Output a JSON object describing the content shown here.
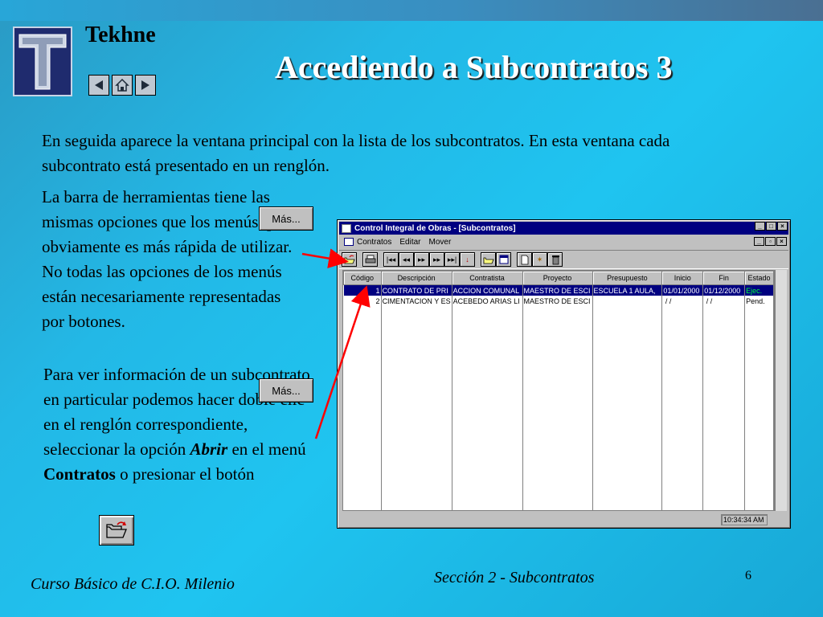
{
  "brand": "Tekhne",
  "title": "Accediendo a Subcontratos 3",
  "intro": "En seguida aparece la ventana principal con la lista de los subcontratos. En esta ventana cada subcontrato está presentado en un renglón.",
  "toolbar_para": "La barra de herramientas tiene las mismas opciones que los menús, pero obviamente es más rápida de utilizar. No todas las opciones de los menús están necesariamente representadas por botones.",
  "open_para": {
    "part1": "Para ver información de un subcontrato en particular podemos hacer doble clic en el renglón correspondiente, seleccionar la opción ",
    "abrir": "Abrir",
    "part2": " en el menú ",
    "contratos": "Contratos",
    "part3": " o presionar el botón"
  },
  "mas_label": "Más...",
  "window": {
    "title": "Control Integral de Obras - [Subcontratos]",
    "menus": [
      "Contratos",
      "Editar",
      "Mover"
    ],
    "columns": [
      "Código",
      "Descripción",
      "Contratista",
      "Proyecto",
      "Presupuesto",
      "Inicio",
      "Fin",
      "Estado"
    ],
    "rows": [
      [
        "1",
        "CONTRATO DE PRI",
        "ACCION COMUNAL",
        "MAESTRO DE ESCI",
        "ESCUELA 1 AULA,",
        "01/01/2000",
        "01/12/2000",
        "Ejec."
      ],
      [
        "2",
        "CIMENTACION Y ES",
        "ACEBEDO ARIAS LI",
        "MAESTRO DE ESCI",
        "",
        " / /",
        " / /",
        "Pend."
      ]
    ],
    "clock": "10:34:34 AM"
  },
  "footer_left": "Curso Básico de C.I.O. Milenio",
  "footer_section": "Sección 2 - Subcontratos",
  "page_number": "6",
  "icons": [
    "tekhne-logo-icon",
    "prev-icon",
    "home-icon",
    "next-icon",
    "open-folder-icon",
    "red-arrow-icon"
  ],
  "colors": {
    "title_text": "#ffffff",
    "titlebar": "#000080",
    "arrow": "#ff0000",
    "ejec_status": "#00ff40"
  }
}
